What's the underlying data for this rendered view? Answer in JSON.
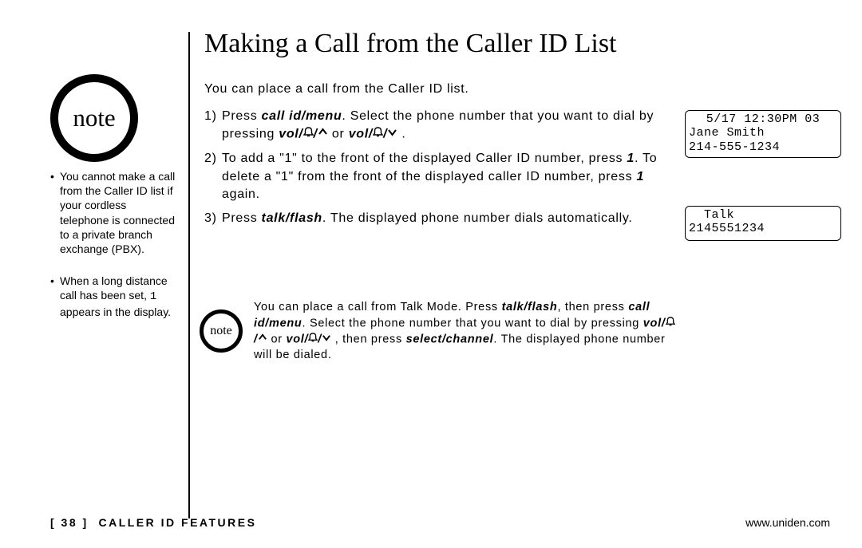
{
  "title": "Making a Call from the Caller ID List",
  "note_label": "note",
  "side_notes": [
    "You cannot make a call from the Caller ID list if your cordless telephone is connected to a private branch exchange (PBX).",
    "When a long distance call has been set, <1> appears in the display."
  ],
  "intro": "You can place a call from the Caller ID list.",
  "steps": {
    "s1a": "Press ",
    "s1b": "call id/menu",
    "s1c": ". Select the phone number that you want to dial by pressing ",
    "s1d": "vol/",
    "s1e": "  or ",
    "s1f": "vol/",
    "s1g": " .",
    "s2": "To add a \"1\" to the front of the displayed Caller ID number, press ",
    "s2b": "1",
    "s2c": ". To delete a \"1\" from the front of the displayed caller ID number, press ",
    "s2d": "1",
    "s2e": " again.",
    "s3a": "Press ",
    "s3b": "talk/flash",
    "s3c": ". The displayed phone number dials automatically."
  },
  "lcd1": {
    "line1": "5/17 12:30PM 03",
    "line2": "Jane Smith",
    "line3": "214-555-1234"
  },
  "lcd2": {
    "line1": "  Talk",
    "line2": "2145551234"
  },
  "inline_note": {
    "a": "You can place a call from Talk Mode. Press ",
    "b": "talk/flash",
    "c": ", then press ",
    "d": "call id/menu",
    "e": ". Select the phone number that you want to dial by pressing ",
    "f": "vol/",
    "g": "  or ",
    "h": "vol/",
    "i": " , then press ",
    "j": "select/channel",
    "k": ". The displayed phone number will be dialed."
  },
  "footer": {
    "page": "[ 38 ]",
    "section": "CALLER ID FEATURES",
    "url": "www.uniden.com"
  },
  "mono1": "1"
}
